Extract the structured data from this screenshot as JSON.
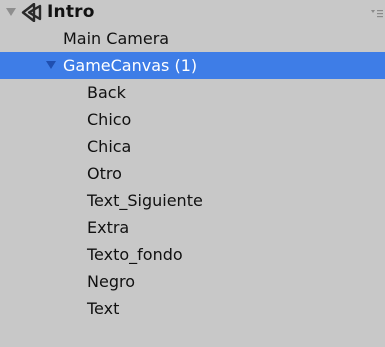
{
  "colors": {
    "panel_background": "#c8c8c8",
    "selection_background": "#3e7de7",
    "selection_text": "#ffffff",
    "text": "#111111"
  },
  "hierarchy": {
    "scene": {
      "name": "Intro",
      "icon": "unity-scene-icon",
      "expanded": true,
      "menu_icon": "context-menu-icon"
    },
    "items": [
      {
        "label": "Main Camera",
        "selected": false
      },
      {
        "label": "GameCanvas (1)",
        "selected": true,
        "expanded": true
      },
      {
        "label": "Back"
      },
      {
        "label": "Chico"
      },
      {
        "label": "Chica"
      },
      {
        "label": "Otro"
      },
      {
        "label": "Text_Siguiente"
      },
      {
        "label": "Extra"
      },
      {
        "label": "Texto_fondo"
      },
      {
        "label": "Negro"
      },
      {
        "label": "Text"
      }
    ]
  }
}
